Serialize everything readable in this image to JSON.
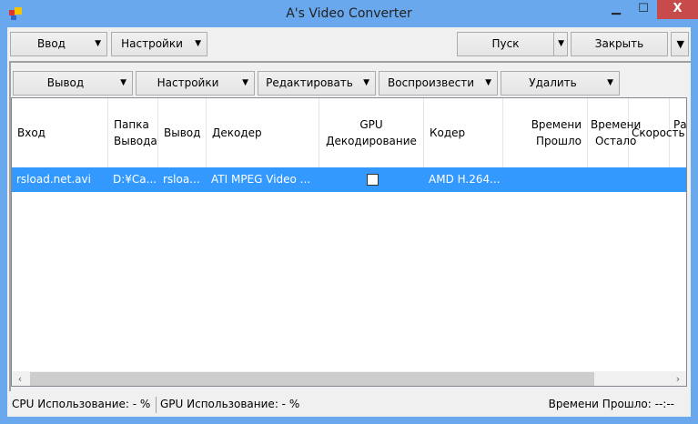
{
  "window": {
    "title": "A's Video Converter",
    "minimize": "▁",
    "maximize": "☐",
    "close": "X"
  },
  "toolbar_top": {
    "input": "Ввод",
    "settings": "Настройки",
    "start": "Пуск",
    "close": "Закрыть",
    "arrow": "▼"
  },
  "toolbar_panel": {
    "output": "Вывод",
    "settings": "Настройки",
    "edit": "Редактировать",
    "play": "Воспроизвести",
    "delete": "Удалить"
  },
  "grid": {
    "columns": [
      "Вход",
      "Папка Вывода",
      "Вывод",
      "Декодер",
      "GPU Декодирование",
      "Кодер",
      "Времени Прошло",
      "Времени Остало",
      "Скорость",
      "Ра"
    ],
    "rows": [
      {
        "input": "rsload.net.avi",
        "folder": "D:¥Ca...",
        "output": "rsloa...",
        "decoder": "ATI MPEG Video ...",
        "gpu_decoding": false,
        "encoder": "AMD H.264...",
        "elapsed": "",
        "remaining": "",
        "speed": ""
      }
    ]
  },
  "status": {
    "cpu": "CPU Использование: - %",
    "gpu": "GPU Использование: - %",
    "elapsed": "Времени Прошло: --:--"
  },
  "colors": {
    "selection": "#3399ff",
    "frame": "#6aa8ee",
    "close_button": "#c74b4b"
  }
}
